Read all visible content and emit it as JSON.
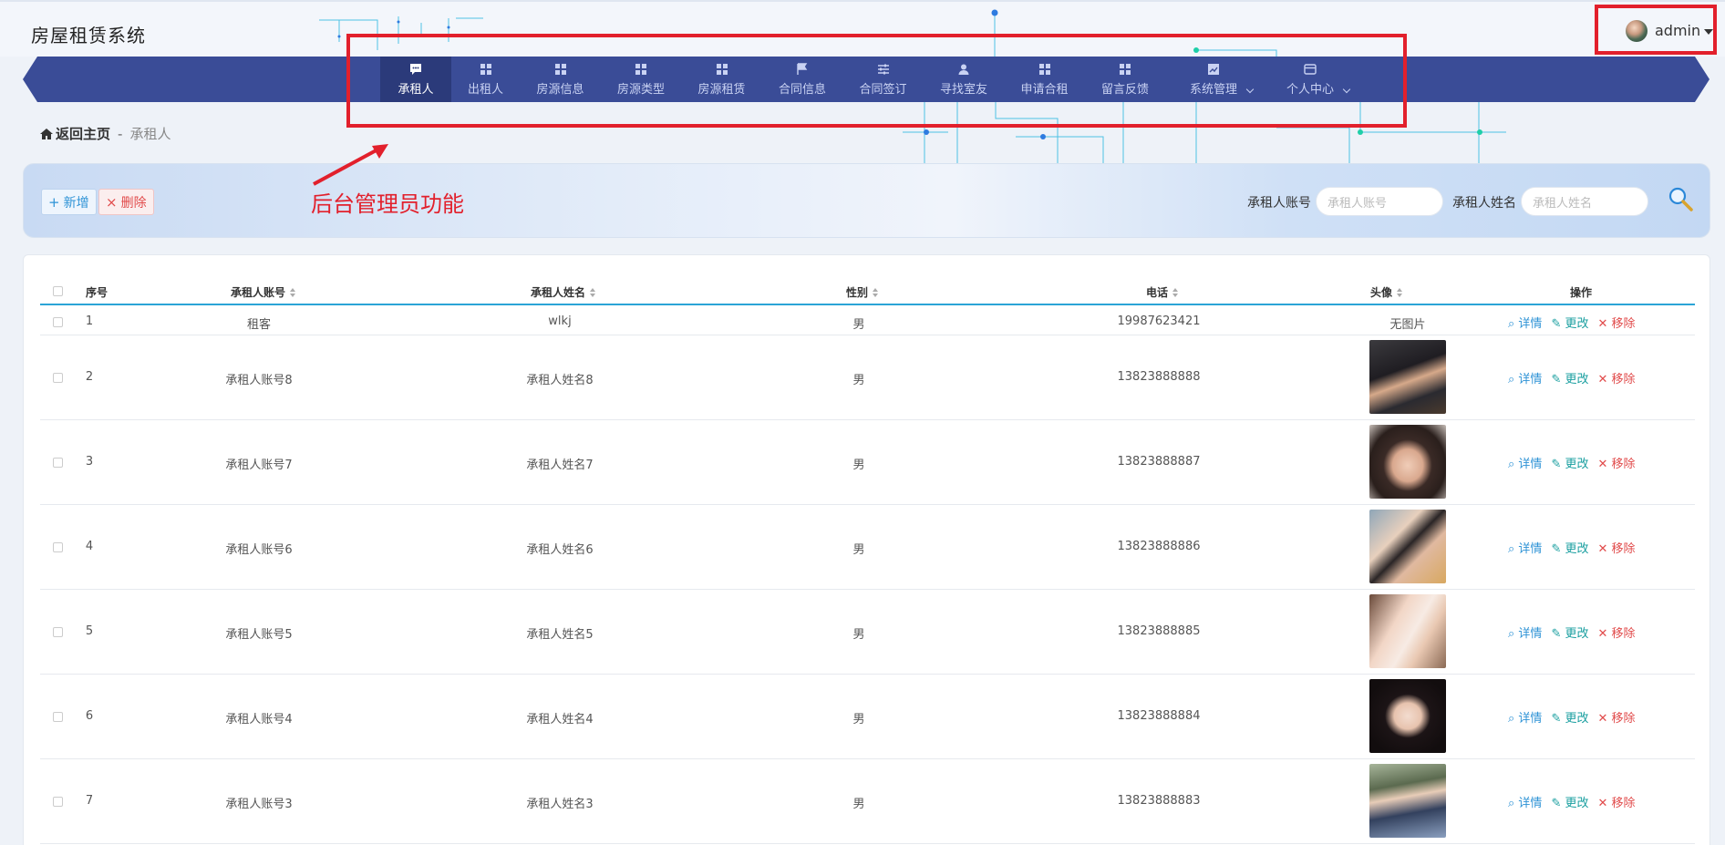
{
  "app": {
    "title": "房屋租赁系统"
  },
  "user": {
    "name": "admin"
  },
  "nav": {
    "items": [
      {
        "label": "承租人",
        "icon": "chat-icon",
        "active": true
      },
      {
        "label": "出租人",
        "icon": "grid-icon"
      },
      {
        "label": "房源信息",
        "icon": "grid-icon"
      },
      {
        "label": "房源类型",
        "icon": "grid-icon"
      },
      {
        "label": "房源租赁",
        "icon": "grid-icon"
      },
      {
        "label": "合同信息",
        "icon": "flag-icon"
      },
      {
        "label": "合同签订",
        "icon": "sliders-icon"
      },
      {
        "label": "寻找室友",
        "icon": "user-icon"
      },
      {
        "label": "申请合租",
        "icon": "grid-icon"
      },
      {
        "label": "留言反馈",
        "icon": "grid-icon"
      },
      {
        "label": "系统管理",
        "icon": "chart-icon",
        "dropdown": true
      },
      {
        "label": "个人中心",
        "icon": "card-icon",
        "dropdown": true
      }
    ]
  },
  "breadcrumb": {
    "home": "返回主页",
    "separator": "-",
    "current": "承租人"
  },
  "actions": {
    "add": "新增",
    "delete": "删除"
  },
  "annotation": {
    "text": "后台管理员功能"
  },
  "search": {
    "account_label": "承租人账号",
    "account_placeholder": "承租人账号",
    "name_label": "承租人姓名",
    "name_placeholder": "承租人姓名"
  },
  "table": {
    "headers": {
      "index": "序号",
      "account": "承租人账号",
      "name": "承租人姓名",
      "gender": "性别",
      "phone": "电话",
      "avatar": "头像",
      "ops": "操作"
    },
    "op_labels": {
      "detail": "详情",
      "edit": "更改",
      "remove": "移除"
    },
    "no_image": "无图片",
    "rows": [
      {
        "index": "1",
        "account": "租客",
        "name": "wlkj",
        "gender": "男",
        "phone": "19987623421",
        "has_avatar": false
      },
      {
        "index": "2",
        "account": "承租人账号8",
        "name": "承租人姓名8",
        "gender": "男",
        "phone": "13823888888",
        "has_avatar": true
      },
      {
        "index": "3",
        "account": "承租人账号7",
        "name": "承租人姓名7",
        "gender": "男",
        "phone": "13823888887",
        "has_avatar": true
      },
      {
        "index": "4",
        "account": "承租人账号6",
        "name": "承租人姓名6",
        "gender": "男",
        "phone": "13823888886",
        "has_avatar": true
      },
      {
        "index": "5",
        "account": "承租人账号5",
        "name": "承租人姓名5",
        "gender": "男",
        "phone": "13823888885",
        "has_avatar": true
      },
      {
        "index": "6",
        "account": "承租人账号4",
        "name": "承租人姓名4",
        "gender": "男",
        "phone": "13823888884",
        "has_avatar": true
      },
      {
        "index": "7",
        "account": "承租人账号3",
        "name": "承租人姓名3",
        "gender": "男",
        "phone": "13823888883",
        "has_avatar": true
      }
    ]
  },
  "colors": {
    "nav_bg": "#3a4c97",
    "nav_active": "#2b3a7a",
    "accent": "#2ba4d6",
    "highlight": "#e2202c"
  }
}
